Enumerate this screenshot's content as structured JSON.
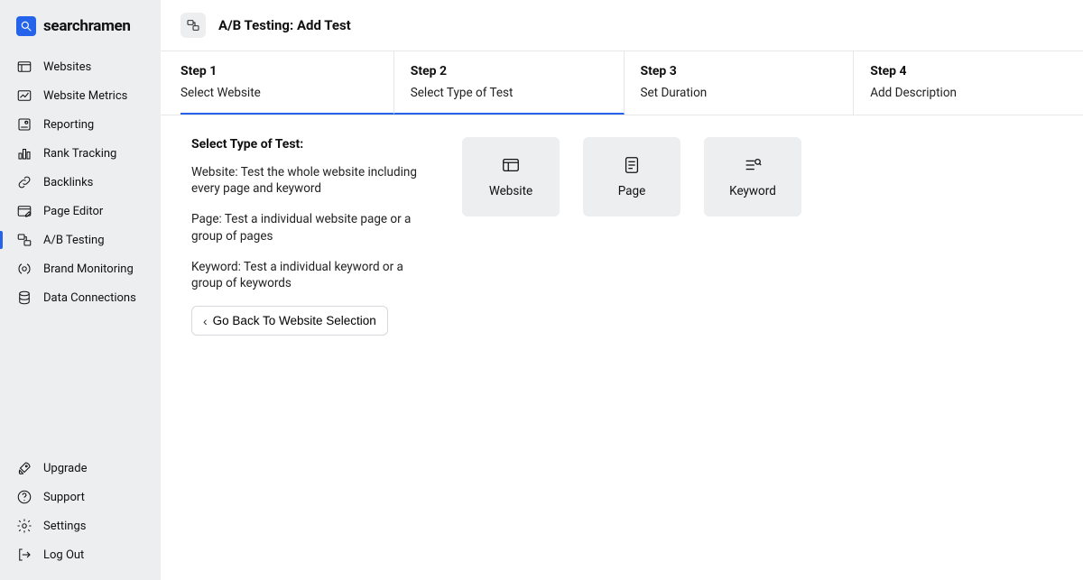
{
  "brand": {
    "name": "searchramen"
  },
  "sidebar": {
    "items": [
      {
        "label": "Websites"
      },
      {
        "label": "Website Metrics"
      },
      {
        "label": "Reporting"
      },
      {
        "label": "Rank Tracking"
      },
      {
        "label": "Backlinks"
      },
      {
        "label": "Page Editor"
      },
      {
        "label": "A/B Testing"
      },
      {
        "label": "Brand Monitoring"
      },
      {
        "label": "Data Connections"
      }
    ],
    "bottom": [
      {
        "label": "Upgrade"
      },
      {
        "label": "Support"
      },
      {
        "label": "Settings"
      },
      {
        "label": "Log Out"
      }
    ]
  },
  "page": {
    "title": "A/B Testing: Add Test"
  },
  "steps": [
    {
      "title": "Step 1",
      "sub": "Select Website"
    },
    {
      "title": "Step 2",
      "sub": "Select Type of Test"
    },
    {
      "title": "Step 3",
      "sub": "Set Duration"
    },
    {
      "title": "Step 4",
      "sub": "Add Description"
    }
  ],
  "typeSection": {
    "heading": "Select Type of Test:",
    "desc": [
      "Website: Test the whole website including every page and keyword",
      "Page: Test a individual website page or a group of pages",
      "Keyword: Test a individual keyword or a group of keywords"
    ],
    "backLabel": "Go Back To Website Selection",
    "cards": [
      {
        "label": "Website"
      },
      {
        "label": "Page"
      },
      {
        "label": "Keyword"
      }
    ]
  }
}
